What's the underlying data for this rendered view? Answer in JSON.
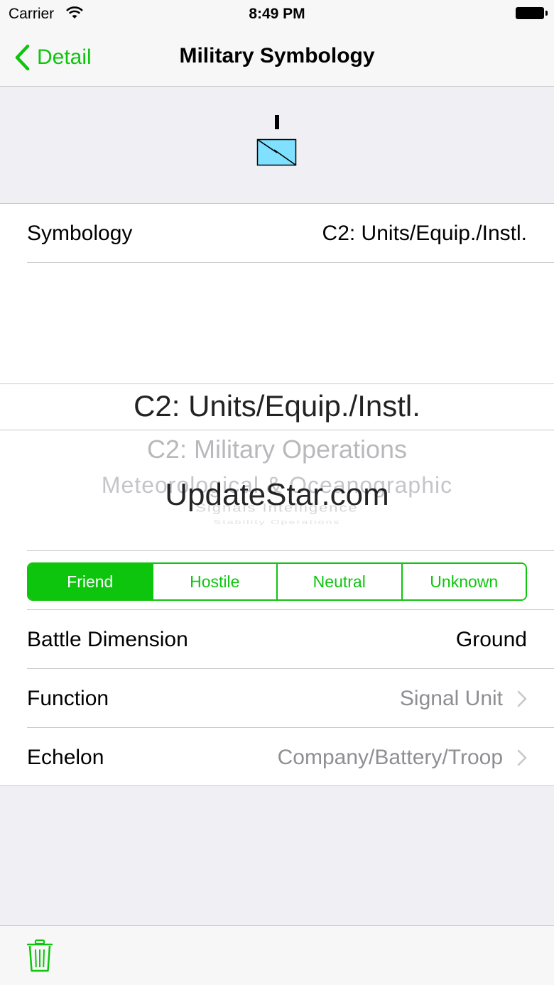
{
  "status_bar": {
    "carrier": "Carrier",
    "time": "8:49 PM"
  },
  "nav": {
    "back_label": "Detail",
    "title": "Military Symbology"
  },
  "symbology_row": {
    "label": "Symbology",
    "value": "C2: Units/Equip./Instl."
  },
  "picker": {
    "selected": "C2: Units/Equip./Instl.",
    "options": [
      "C2: Military Operations",
      "Meteorological & Oceanographic",
      "Signals Intelligence",
      "Stability Operations"
    ]
  },
  "watermark": "UpdateStar.com",
  "affiliation": {
    "segments": [
      "Friend",
      "Hostile",
      "Neutral",
      "Unknown"
    ],
    "selected": "Friend"
  },
  "battle_dimension": {
    "label": "Battle Dimension",
    "value": "Ground"
  },
  "function_row": {
    "label": "Function",
    "value": "Signal Unit"
  },
  "echelon_row": {
    "label": "Echelon",
    "value": "Company/Battery/Troop"
  },
  "colors": {
    "accent": "#0ec50e",
    "symbol_fill": "#80e0ff",
    "background": "#efeff4"
  },
  "icons": [
    "wifi-icon",
    "battery-icon",
    "back-chevron-icon",
    "military-symbol-icon",
    "chevron-right-icon",
    "trash-icon"
  ]
}
